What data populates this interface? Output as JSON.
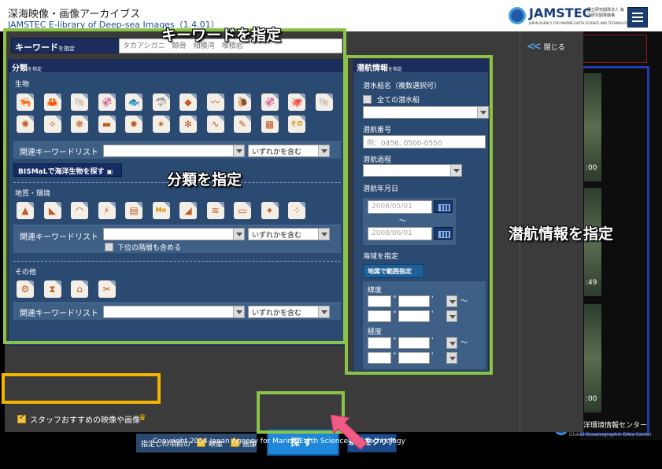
{
  "header": {
    "site_title": "深海映像・画像アーカイブス",
    "site_subtitle": "JAMSTEC E-library of Deep-sea Images（1.4.01）",
    "logo_text": "JAMSTEC",
    "logo_jp": "国立研究開発法人 海洋研究開発機構",
    "logo_en": "JAPAN AGENCY FOR MARINE-EARTH SCIENCE AND TECHNOLOGY"
  },
  "modal": {
    "close_label": "閉じる",
    "keyword": {
      "label": "キーワード",
      "label_suffix": "を指定",
      "placeholder": "タカアシガニ　鯨骨　相模湾　堆積岩"
    },
    "classification": {
      "header": "分類",
      "header_suffix": "を指定",
      "bio_title": "生物",
      "bio_icons": [
        "shrimp-icon",
        "crab-icon",
        "hermit-crab-icon",
        "squid-icon",
        "fish-icon",
        "shark-icon",
        "ray-icon",
        "eel-icon",
        "snail-icon",
        "cephalopod-icon",
        "octopus-icon",
        "shell-icon",
        "anemone-icon",
        "jellyfish-icon",
        "siphonophore-icon",
        "sea-cucumber-icon",
        "urchin-icon",
        "starfish-icon",
        "coral-icon",
        "worm-icon",
        "sea-pen-icon",
        "sponge-icon",
        "other-bio-icon"
      ],
      "bio_other_label": "その他",
      "related_kw_label": "関連キーワードリスト",
      "match_option": "いずれかを含む",
      "bismal_label": "BISMaLで海洋生物を探す",
      "geo_title": "地質・環境",
      "geo_icons": [
        "rock-icon",
        "slope-icon",
        "seamount-icon",
        "vent-icon",
        "outcrop-icon",
        "manganese-icon",
        "sediment-icon",
        "wave-icon",
        "seafloor-icon",
        "plume-icon",
        "nodule-icon"
      ],
      "geo_mn_label": "Mn",
      "include_lower_label": "下位の階層も含める",
      "other_title": "その他",
      "other_icons": [
        "equipment-icon",
        "whale-fall-icon",
        "debris-icon",
        "sampler-icon"
      ]
    },
    "dive": {
      "header": "潜航情報",
      "header_suffix": "を指定",
      "vessel_label": "潜水船名（複数選択可）",
      "all_vessels_label": "全ての潜水船",
      "dive_no_label": "潜航番号",
      "dive_no_placeholder": "例：0456, 0500-0550",
      "cruise_label": "潜航過程",
      "date_label": "潜航年月日",
      "date_from": "2008/05/01",
      "date_sep": "〜",
      "date_to": "2008/06/01",
      "area_label": "海域を指定",
      "map_button": "地図で範囲指定",
      "lat_label": "緯度",
      "lon_label": "経度",
      "deg": "°",
      "min": "'",
      "tilde": "〜"
    },
    "bottom": {
      "staff_label": "スタッフおすすめの映像や画像",
      "target_label": "指定した項目の",
      "video_label": "映像",
      "image_label": "画像",
      "search_button": "探す",
      "clear_button": "条件をクリア"
    }
  },
  "background": {
    "times": [
      ":00",
      ":49",
      ":00"
    ],
    "center_name": "深海洋環境情報センター",
    "center_en": "Global Oceanographic DAta Center"
  },
  "copyright": "Copyright 2014 Japan Agency for Marine-Earth Science and Technology",
  "annotations": {
    "keyword": "キーワードを指定",
    "classification": "分類を指定",
    "dive": "潜航情報を指定"
  },
  "colors": {
    "highlight_green": "#8bc34a",
    "highlight_orange": "#f4b400",
    "arrow_pink": "#f25a86",
    "panel_blue": "#2b4a72",
    "header_navy": "#1a2d5c",
    "search_blue": "#1f87d8"
  }
}
